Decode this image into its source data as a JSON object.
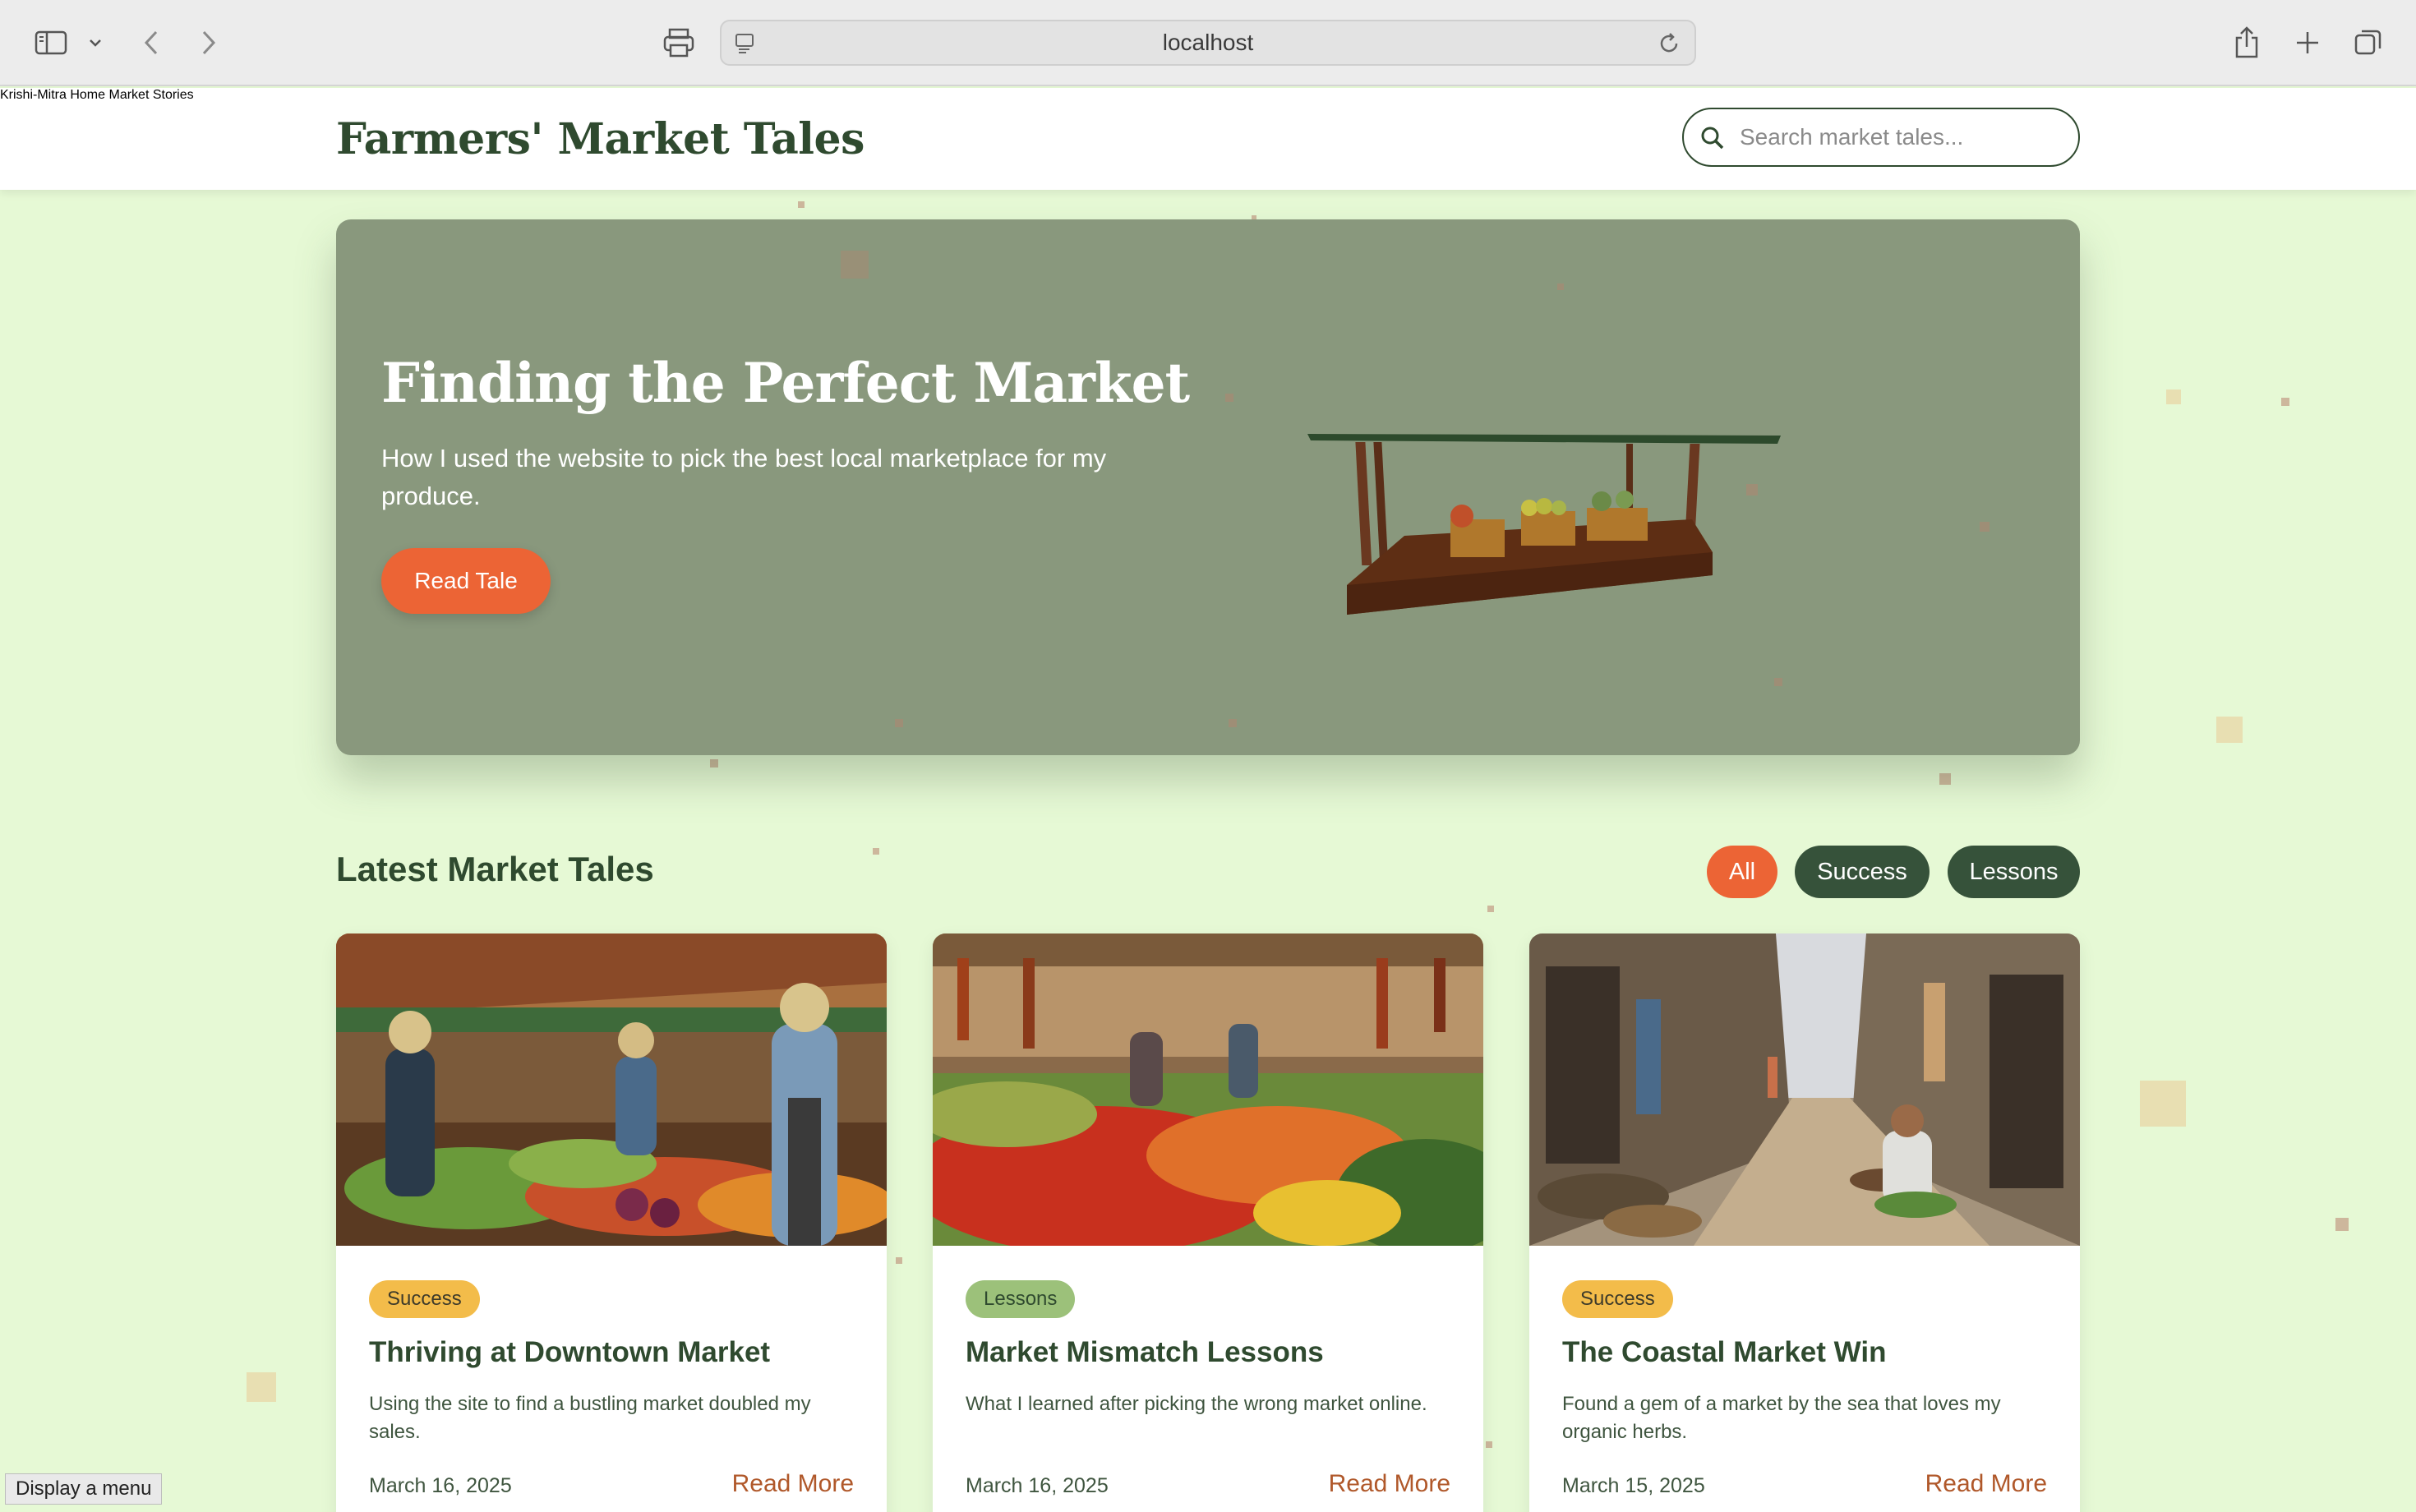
{
  "browser": {
    "url": "localhost",
    "icons": [
      "sidebar-icon",
      "chevron-down-icon",
      "back-icon",
      "forward-icon",
      "print-icon",
      "site-settings-icon",
      "reload-icon",
      "share-icon",
      "new-tab-icon",
      "tabs-overview-icon"
    ]
  },
  "header": {
    "brand": "Farmers' Market Tales",
    "nav": [
      "Krishi-Mitra",
      "Home",
      "Market Stories"
    ],
    "search_placeholder": "Search market tales..."
  },
  "hero": {
    "title": "Finding the Perfect Market",
    "subtitle": "How I used the website to pick the best local marketplace for my produce.",
    "cta": "Read Tale"
  },
  "section": {
    "title": "Latest Market Tales",
    "filters": [
      "All",
      "Success",
      "Lessons"
    ],
    "active_filter": "All"
  },
  "cards": [
    {
      "tag": "Success",
      "title": "Thriving at Downtown Market",
      "description": "Using the site to find a bustling market doubled my sales.",
      "date": "March 16, 2025",
      "link": "Read More"
    },
    {
      "tag": "Lessons",
      "title": "Market Mismatch Lessons",
      "description": "What I learned after picking the wrong market online.",
      "date": "March 16, 2025",
      "link": "Read More"
    },
    {
      "tag": "Success",
      "title": "The Coastal Market Win",
      "description": "Found a gem of a market by the sea that loves my organic herbs.",
      "date": "March 15, 2025",
      "link": "Read More"
    }
  ],
  "tooltip": "Display a menu",
  "colors": {
    "page_bg": "#e6f9d5",
    "accent": "#ec6435",
    "dark_green": "#2f4a2f",
    "hero_bg": "#89987d",
    "success_tag": "#f3bc4a",
    "lessons_tag": "#9cc17a"
  }
}
